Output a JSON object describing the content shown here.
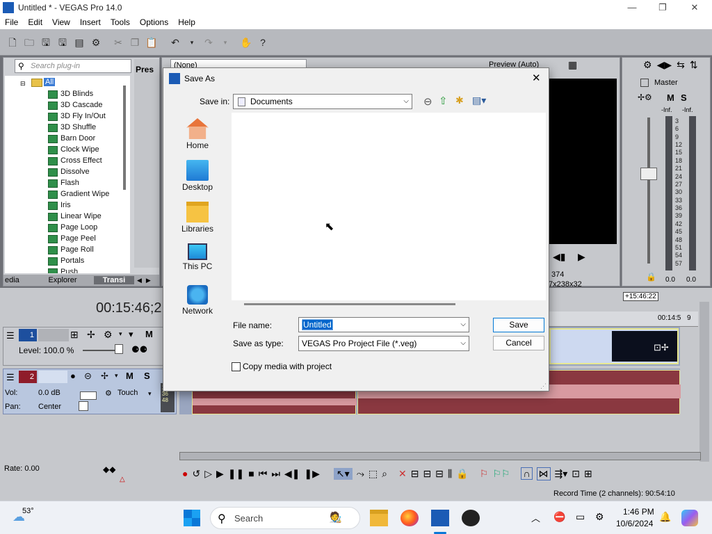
{
  "window": {
    "title": "Untitled * - VEGAS Pro 14.0",
    "minimize": "—",
    "maximize": "❐",
    "close": "✕"
  },
  "menu": [
    "File",
    "Edit",
    "View",
    "Insert",
    "Tools",
    "Options",
    "Help"
  ],
  "explorer": {
    "search_placeholder": "Search plug-in",
    "root": "All",
    "items": [
      "3D Blinds",
      "3D Cascade",
      "3D Fly In/Out",
      "3D Shuffle",
      "Barn Door",
      "Clock Wipe",
      "Cross Effect",
      "Dissolve",
      "Flash",
      "Gradient Wipe",
      "Iris",
      "Linear Wipe",
      "Page Loop",
      "Page Peel",
      "Page Roll",
      "Portals",
      "Push"
    ],
    "presets_label": "Pres",
    "tabs": [
      "edia",
      "Explorer",
      "Transi"
    ]
  },
  "preview": {
    "dropdown": "(None)",
    "mode": "Preview (Auto)",
    "frame": "374",
    "size": "7x238x32"
  },
  "master": {
    "label": "Master",
    "m": "M",
    "s": "S",
    "inf1": "-Inf.",
    "inf2": "-Inf.",
    "scale": [
      "3",
      "6",
      "9",
      "12",
      "15",
      "18",
      "21",
      "24",
      "27",
      "30",
      "33",
      "36",
      "39",
      "42",
      "45",
      "48",
      "51",
      "54",
      "57"
    ],
    "val1": "0.0",
    "val2": "0.0"
  },
  "timeline": {
    "timecode": "00:15:46;2",
    "marker": "+15:46:22",
    "ruler": "00:14:5",
    "ruler2": "9",
    "track1": {
      "num": "1",
      "level": "Level: 100.0 %",
      "m": "M"
    },
    "track2": {
      "num": "2",
      "vol_label": "Vol:",
      "vol": "0.0 dB",
      "pan_label": "Pan:",
      "pan": "Center",
      "touch": "Touch",
      "m": "M",
      "s": "S",
      "db": [
        "24",
        "36",
        "48"
      ]
    },
    "rate": "Rate: 0.00",
    "record_time": "Record Time (2 channels): 90:54:10"
  },
  "dialog": {
    "title": "Save As",
    "save_in_label": "Save in:",
    "save_in": "Documents",
    "places": [
      "Home",
      "Desktop",
      "Libraries",
      "This PC",
      "Network"
    ],
    "file_name_label": "File name:",
    "file_name": "Untitled",
    "save_type_label": "Save as type:",
    "save_type": "VEGAS Pro Project File (*.veg)",
    "save": "Save",
    "cancel": "Cancel",
    "copy_media": "Copy media with project"
  },
  "taskbar": {
    "weather": "53°",
    "search": "Search",
    "time": "1:46 PM",
    "date": "10/6/2024"
  }
}
